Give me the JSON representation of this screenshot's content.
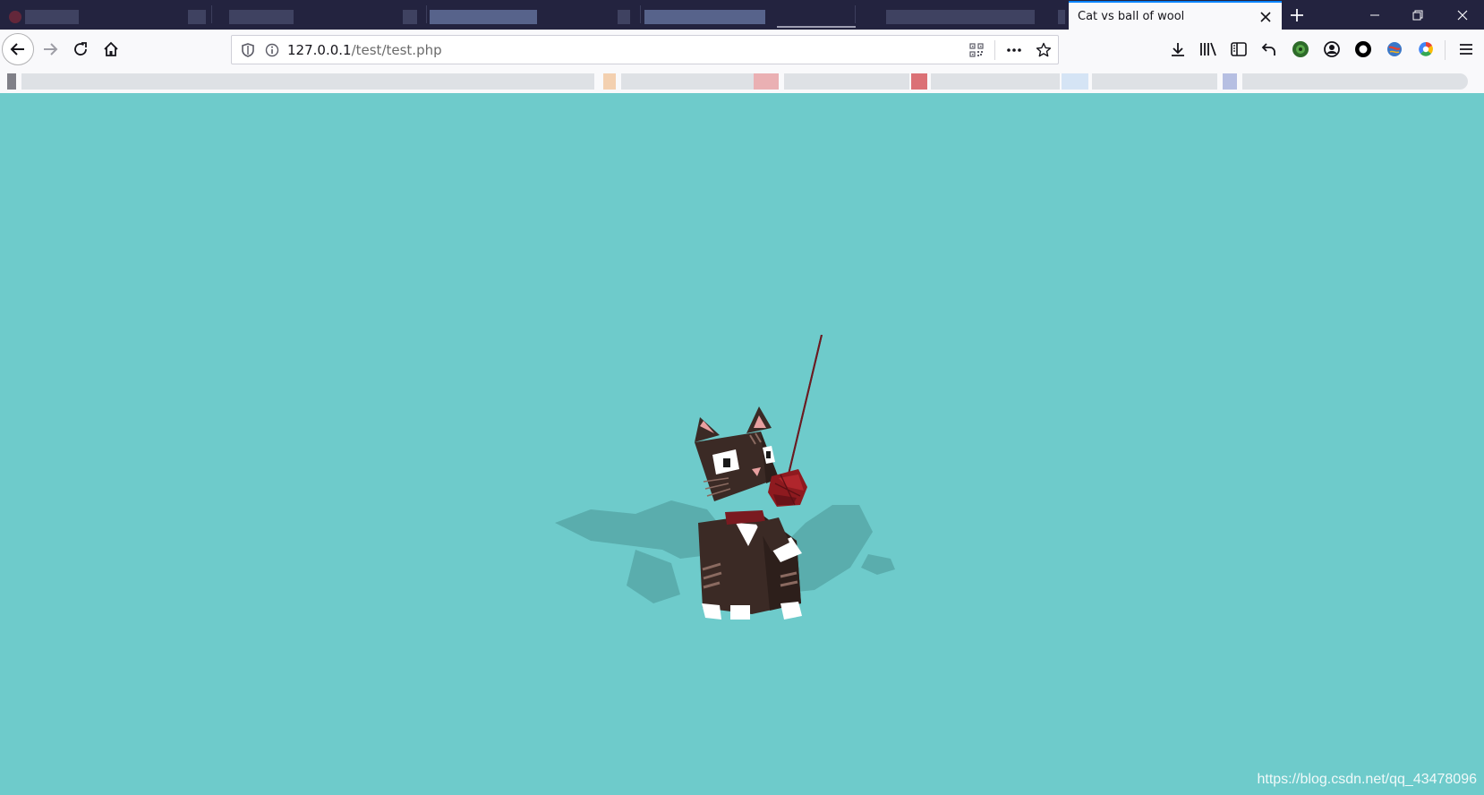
{
  "browser": {
    "active_tab": {
      "title": "Cat vs ball of wool"
    },
    "url": {
      "host": "127.0.0.1",
      "path": "/test/test.php"
    },
    "icons": {
      "tab_close": "close-icon",
      "new_tab": "plus-icon",
      "minimize": "minimize-icon",
      "restore": "restore-icon",
      "window_close": "close-icon",
      "back": "arrow-left-icon",
      "forward": "arrow-right-icon",
      "reload": "reload-icon",
      "home": "home-icon",
      "shield": "shield-icon",
      "info": "info-icon",
      "qr": "qr-code-icon",
      "more": "ellipsis-icon",
      "star": "star-icon",
      "download": "download-icon",
      "library": "library-icon",
      "sidebar": "sidebar-icon",
      "undo": "undo-icon",
      "extensions": [
        "green-circle-icon",
        "account-icon",
        "ring-icon",
        "globe-icon",
        "color-wheel-icon"
      ],
      "menu": "hamburger-icon"
    }
  },
  "content": {
    "background_color": "#6ecbcb",
    "scene": "cat-with-ball-of-wool",
    "cat_color": "#3b2a25",
    "wool_color": "#8e1a1f",
    "watermark": "https://blog.csdn.net/qq_43478096"
  }
}
